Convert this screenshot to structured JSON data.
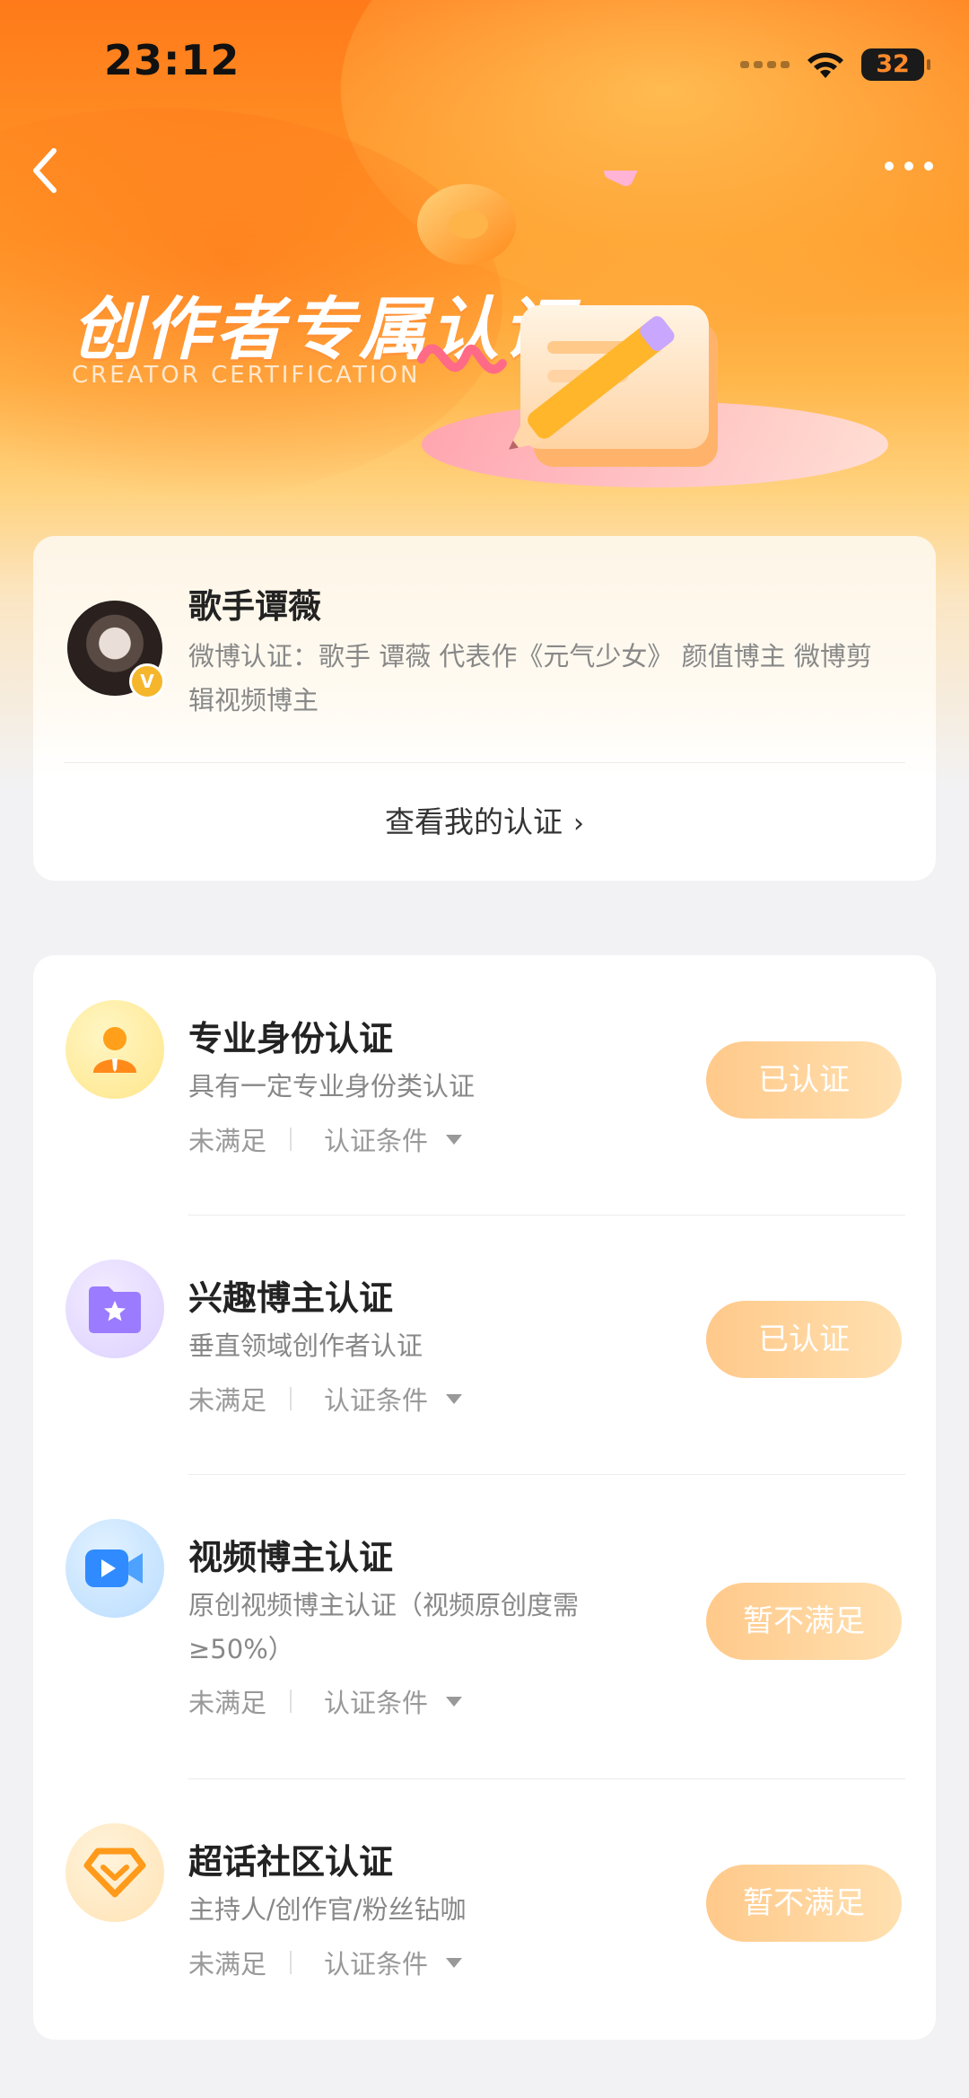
{
  "status_bar": {
    "time": "23:12",
    "battery": "32"
  },
  "banner": {
    "title": "创作者专属认证",
    "subtitle": "CREATOR CERTIFICATION"
  },
  "profile": {
    "name": "歌手谭薇",
    "badge": "V",
    "description": "微博认证：歌手 谭薇 代表作《元气少女》 颜值博主 微博剪辑视频博主",
    "view_link": "查看我的认证"
  },
  "certifications": [
    {
      "title": "专业身份认证",
      "desc": "具有一定专业身份类认证",
      "status": "未满足",
      "conditions": "认证条件",
      "button": "已认证"
    },
    {
      "title": "兴趣博主认证",
      "desc": "垂直领域创作者认证",
      "status": "未满足",
      "conditions": "认证条件",
      "button": "已认证"
    },
    {
      "title": "视频博主认证",
      "desc": "原创视频博主认证（视频原创度需≥50%）",
      "status": "未满足",
      "conditions": "认证条件",
      "button": "暂不满足"
    },
    {
      "title": "超话社区认证",
      "desc": "主持人/创作官/粉丝钻咖",
      "status": "未满足",
      "conditions": "认证条件",
      "button": "暂不满足"
    }
  ],
  "colors": {
    "accent": "#ff8a1a",
    "button_gradient_start": "#ffc98a",
    "button_gradient_end": "#ffe0b0"
  }
}
